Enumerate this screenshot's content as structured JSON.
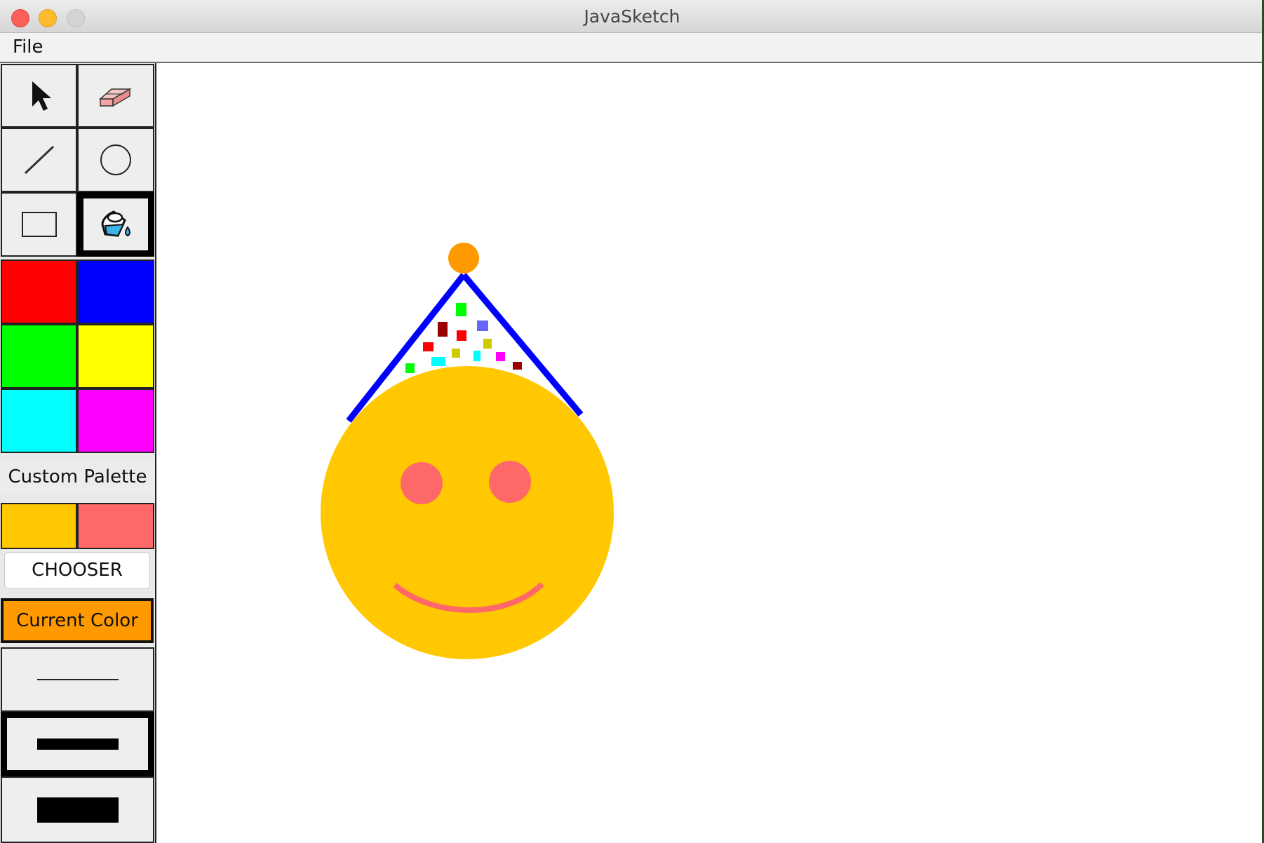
{
  "window": {
    "title": "JavaSketch"
  },
  "menubar": {
    "file_label": "File"
  },
  "tools": [
    {
      "name": "select",
      "icon": "arrow-pointer-icon",
      "selected": false
    },
    {
      "name": "eraser",
      "icon": "eraser-icon",
      "selected": false
    },
    {
      "name": "line",
      "icon": "line-tool-icon",
      "selected": false
    },
    {
      "name": "oval",
      "icon": "circle-tool-icon",
      "selected": false
    },
    {
      "name": "rectangle",
      "icon": "rectangle-tool-icon",
      "selected": false
    },
    {
      "name": "fill",
      "icon": "paint-bucket-icon",
      "selected": true
    }
  ],
  "palette": {
    "preset_colors": [
      "#ff0000",
      "#0000ff",
      "#00ff00",
      "#ffff00",
      "#00ffff",
      "#ff00ff"
    ],
    "custom_label": "Custom Palette",
    "custom_colors": [
      "#ffc800",
      "#ff6868"
    ],
    "chooser_label": "CHOOSER",
    "current_color_label": "Current Color",
    "current_color": "#ff9900"
  },
  "stroke_widths": [
    {
      "name": "thin",
      "selected": false
    },
    {
      "name": "medium",
      "selected": true
    },
    {
      "name": "thick",
      "selected": false
    }
  ],
  "drawing": {
    "face_color": "#ffc800",
    "cheek_color": "#ff6868",
    "hat_color": "#0000ff",
    "pompom_color": "#ff9900",
    "confetti_colors": [
      "#00ff00",
      "#990000",
      "#6666ff",
      "#ff0000",
      "#cccc00",
      "#00ffff",
      "#ff00ff"
    ]
  }
}
